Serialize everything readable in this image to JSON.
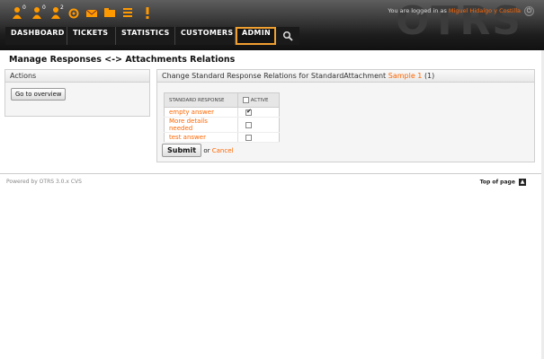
{
  "header": {
    "watermark": "OTRS",
    "toolbar": [
      {
        "name": "locked-tickets-new-icon",
        "count": "0"
      },
      {
        "name": "locked-tickets-reminder-icon",
        "count": "0"
      },
      {
        "name": "responsible-tickets-icon",
        "count": "2"
      },
      {
        "name": "watched-tickets-icon",
        "count": ""
      },
      {
        "name": "new-email-ticket-icon",
        "count": ""
      },
      {
        "name": "new-phone-ticket-icon",
        "count": ""
      },
      {
        "name": "queue-view-icon",
        "count": ""
      },
      {
        "name": "escalation-view-icon",
        "count": ""
      }
    ],
    "login_prefix": "You are logged in as",
    "user_name": "Miguel Hidalgo y Costilla"
  },
  "nav": {
    "items": [
      "DASHBOARD",
      "TICKETS",
      "STATISTICS",
      "CUSTOMERS",
      "ADMIN"
    ],
    "active": "ADMIN"
  },
  "page": {
    "title": "Manage Responses <-> Attachments Relations"
  },
  "actions": {
    "header": "Actions",
    "overview_button": "Go to overview"
  },
  "relations": {
    "header_prefix": "Change Standard Response Relations for StandardAttachment",
    "header_link": "Sample 1",
    "header_suffix": "(1)",
    "col_response": "STANDARD RESPONSE",
    "col_active": "ACTIVE",
    "rows": [
      {
        "name": "empty answer",
        "active": true
      },
      {
        "name": "More details needed",
        "active": false
      },
      {
        "name": "test answer",
        "active": false
      }
    ],
    "submit": "Submit",
    "or": "or",
    "cancel": "Cancel"
  },
  "footer": {
    "powered": "Powered by OTRS 3.0.x CVS",
    "top": "Top of page"
  },
  "colors": {
    "accent": "#f60",
    "active_tab_border": "#f0a030"
  }
}
